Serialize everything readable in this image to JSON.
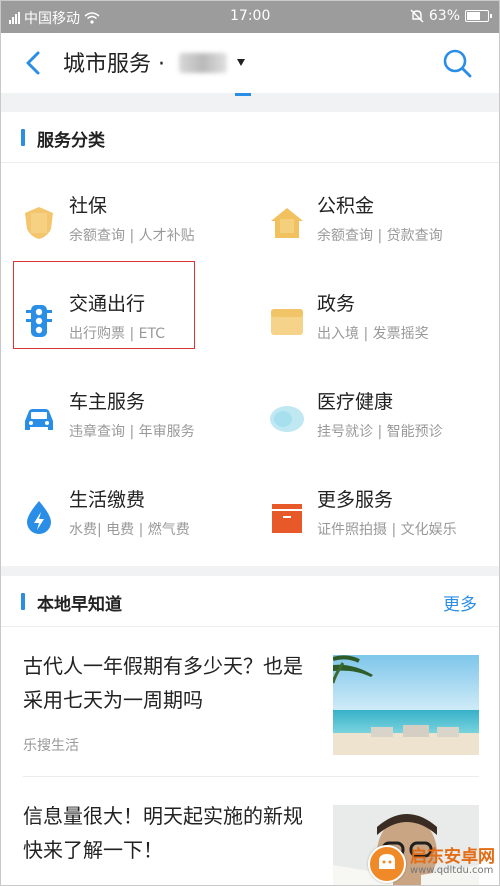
{
  "status_bar": {
    "carrier": "中国移动",
    "time": "17:00",
    "battery": "63%",
    "battery_level": 0.63
  },
  "header": {
    "title": "城市服务 ·"
  },
  "services": {
    "title": "服务分类",
    "items": [
      {
        "name": "社保",
        "sub": "余额查询 | 人才补贴",
        "icon": "shield-icon"
      },
      {
        "name": "公积金",
        "sub": "余额查询 | 贷款查询",
        "icon": "house-icon"
      },
      {
        "name": "交通出行",
        "sub": "出行购票 | ETC",
        "icon": "traffic-light-icon"
      },
      {
        "name": "政务",
        "sub": "出入境 | 发票摇奖",
        "icon": "government-icon"
      },
      {
        "name": "车主服务",
        "sub": "违章查询 | 年审服务",
        "icon": "car-icon"
      },
      {
        "name": "医疗健康",
        "sub": "挂号就诊 | 智能预诊",
        "icon": "medical-icon"
      },
      {
        "name": "生活缴费",
        "sub": "水费| 电费 | 燃气费",
        "icon": "water-drop-bolt-icon"
      },
      {
        "name": "更多服务",
        "sub": "证件照拍摄 | 文化娱乐",
        "icon": "box-icon"
      }
    ]
  },
  "local_news": {
    "title": "本地早知道",
    "more": "更多",
    "items": [
      {
        "headline": "古代人一年假期有多少天？也是采用七天为一周期吗",
        "source": "乐搜生活"
      },
      {
        "headline": "信息量很大！明天起实施的新规快来了解一下！",
        "source": ""
      }
    ]
  },
  "watermark": {
    "name": "启东安卓网",
    "url": "www.qdltdu.com"
  }
}
